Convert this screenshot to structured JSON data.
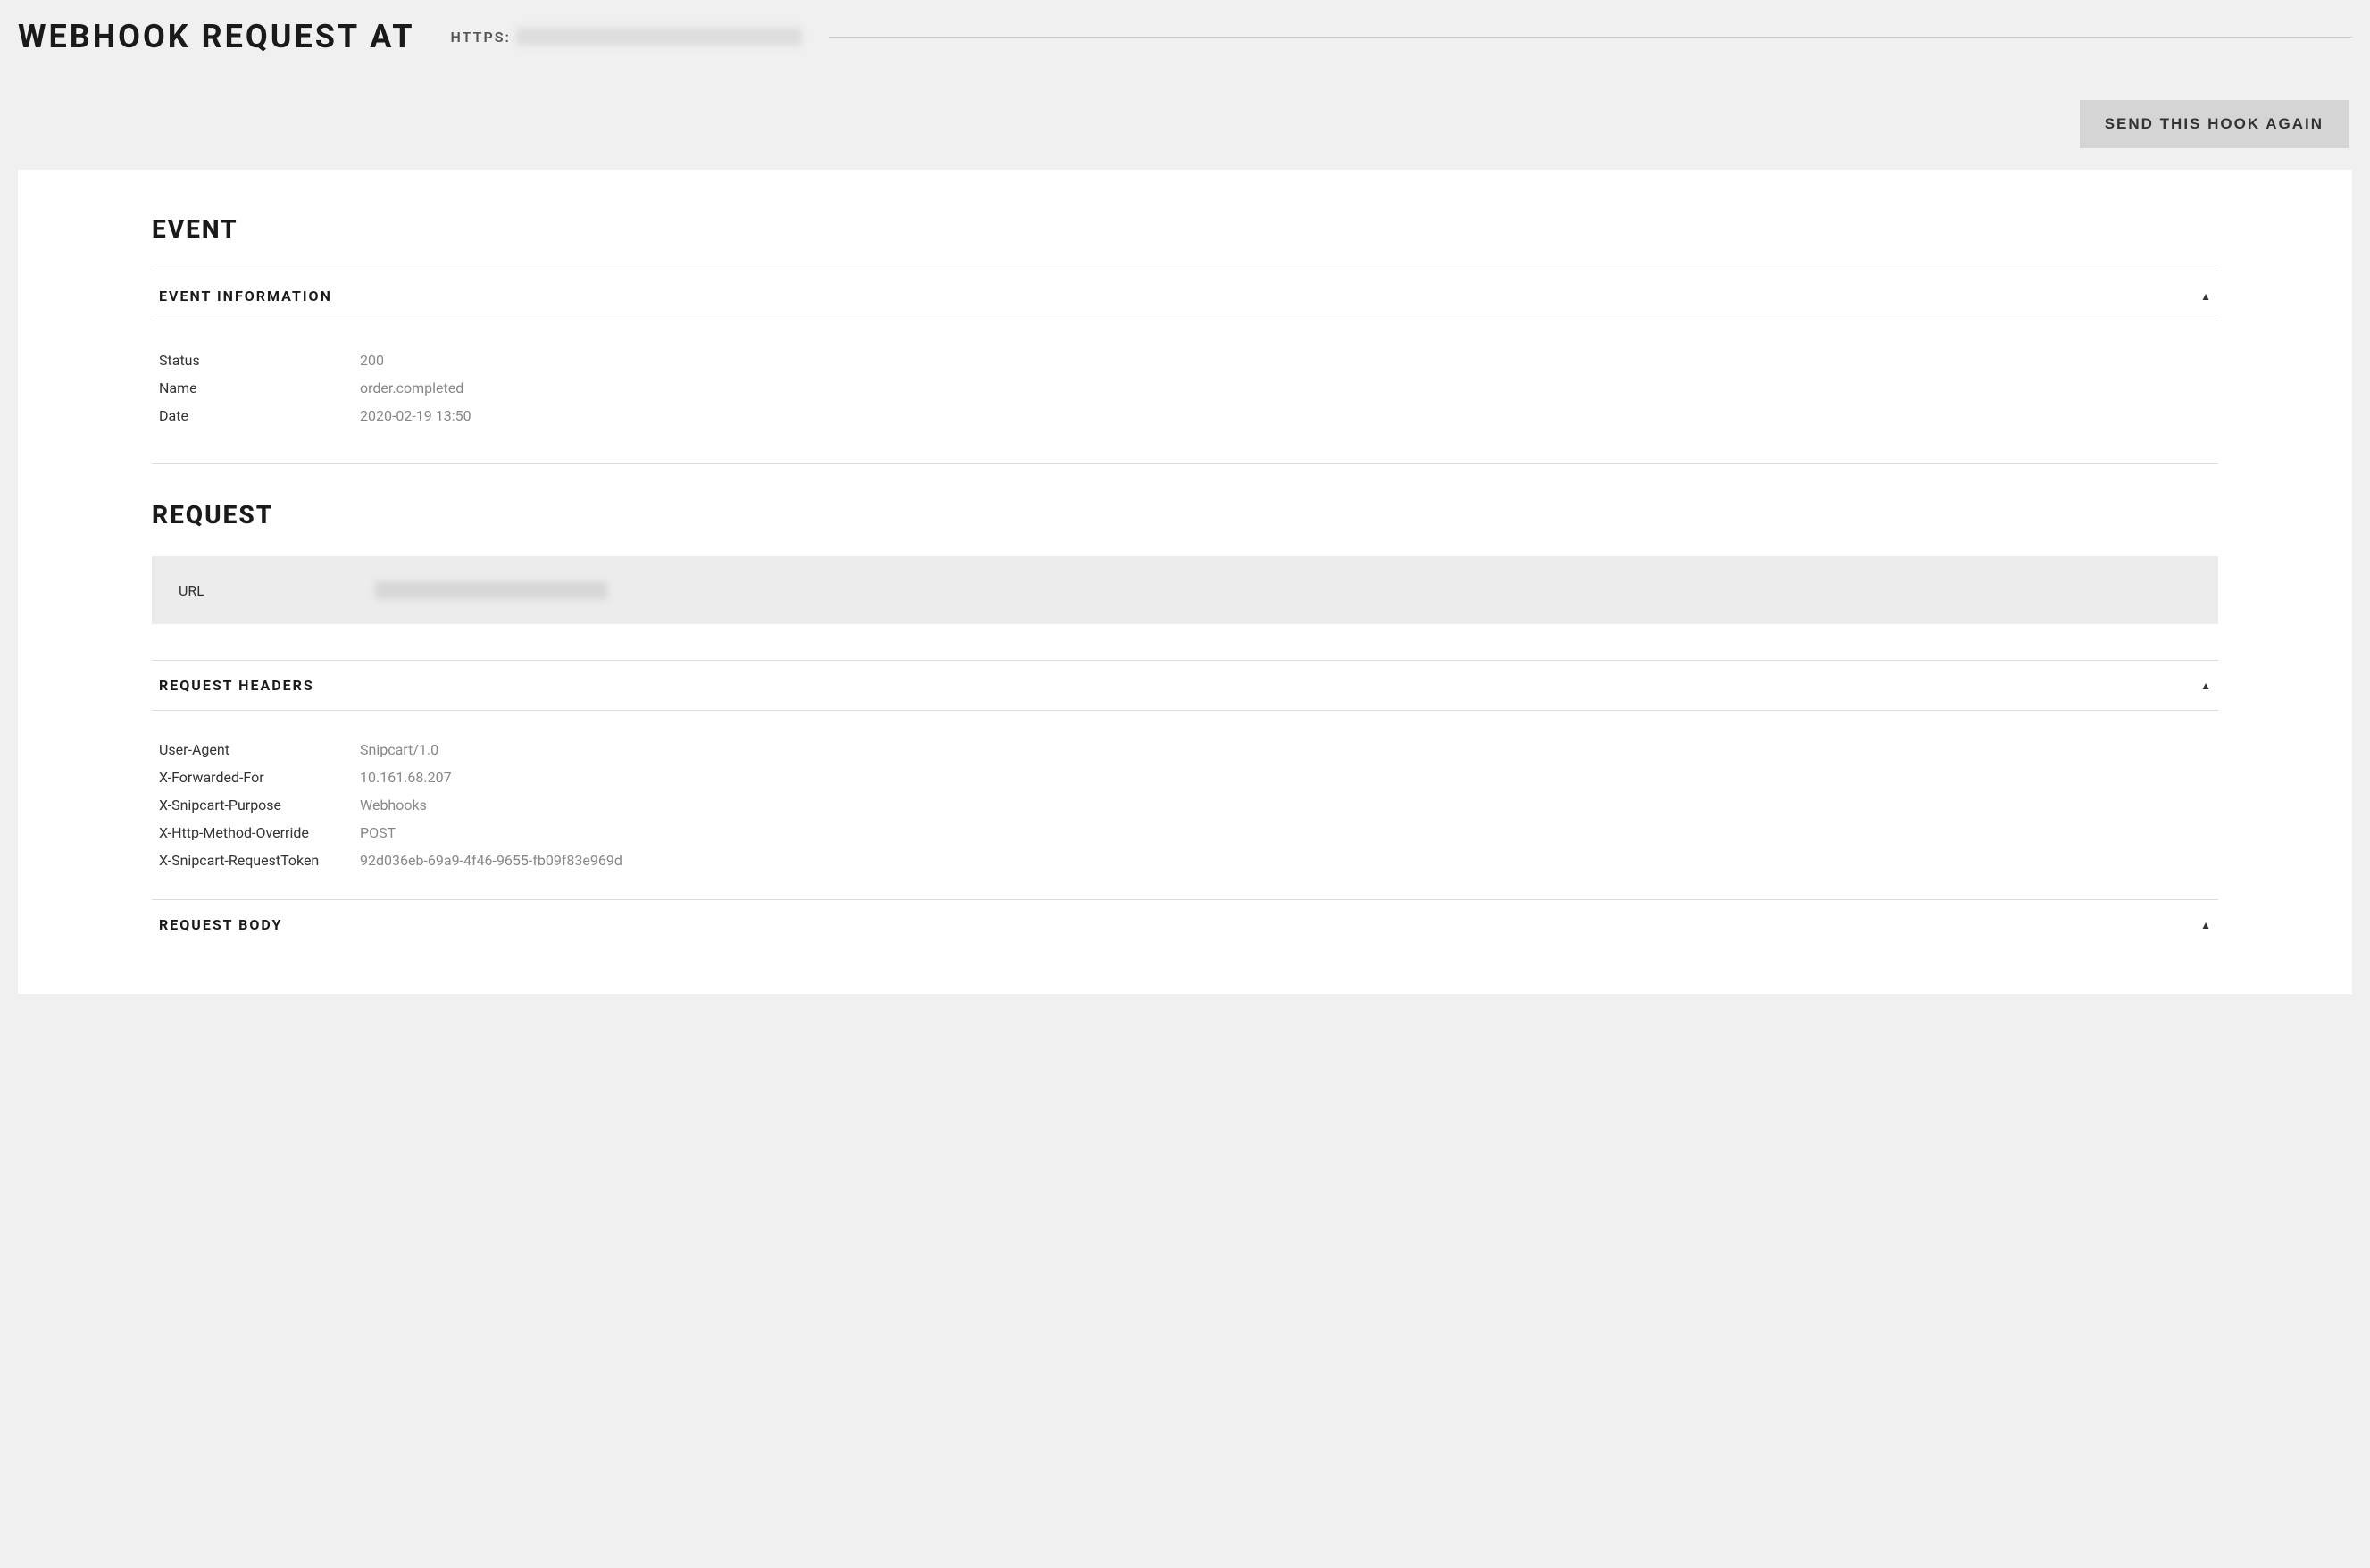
{
  "header": {
    "title": "WEBHOOK REQUEST AT",
    "url_prefix": "HTTPS:"
  },
  "actions": {
    "send_again_label": "SEND THIS HOOK AGAIN"
  },
  "event_section": {
    "title": "EVENT",
    "accordion_label": "EVENT INFORMATION",
    "rows": {
      "status_key": "Status",
      "status_val": "200",
      "name_key": "Name",
      "name_val": "order.completed",
      "date_key": "Date",
      "date_val": "2020-02-19 13:50"
    }
  },
  "request_section": {
    "title": "REQUEST",
    "url_label": "URL",
    "headers_accordion_label": "REQUEST HEADERS",
    "body_accordion_label": "REQUEST BODY",
    "headers": {
      "ua_key": "User-Agent",
      "ua_val": "Snipcart/1.0",
      "xff_key": "X-Forwarded-For",
      "xff_val": "10.161.68.207",
      "purpose_key": "X-Snipcart-Purpose",
      "purpose_val": "Webhooks",
      "method_key": "X-Http-Method-Override",
      "method_val": "POST",
      "token_key": "X-Snipcart-RequestToken",
      "token_val": "92d036eb-69a9-4f46-9655-fb09f83e969d"
    }
  }
}
